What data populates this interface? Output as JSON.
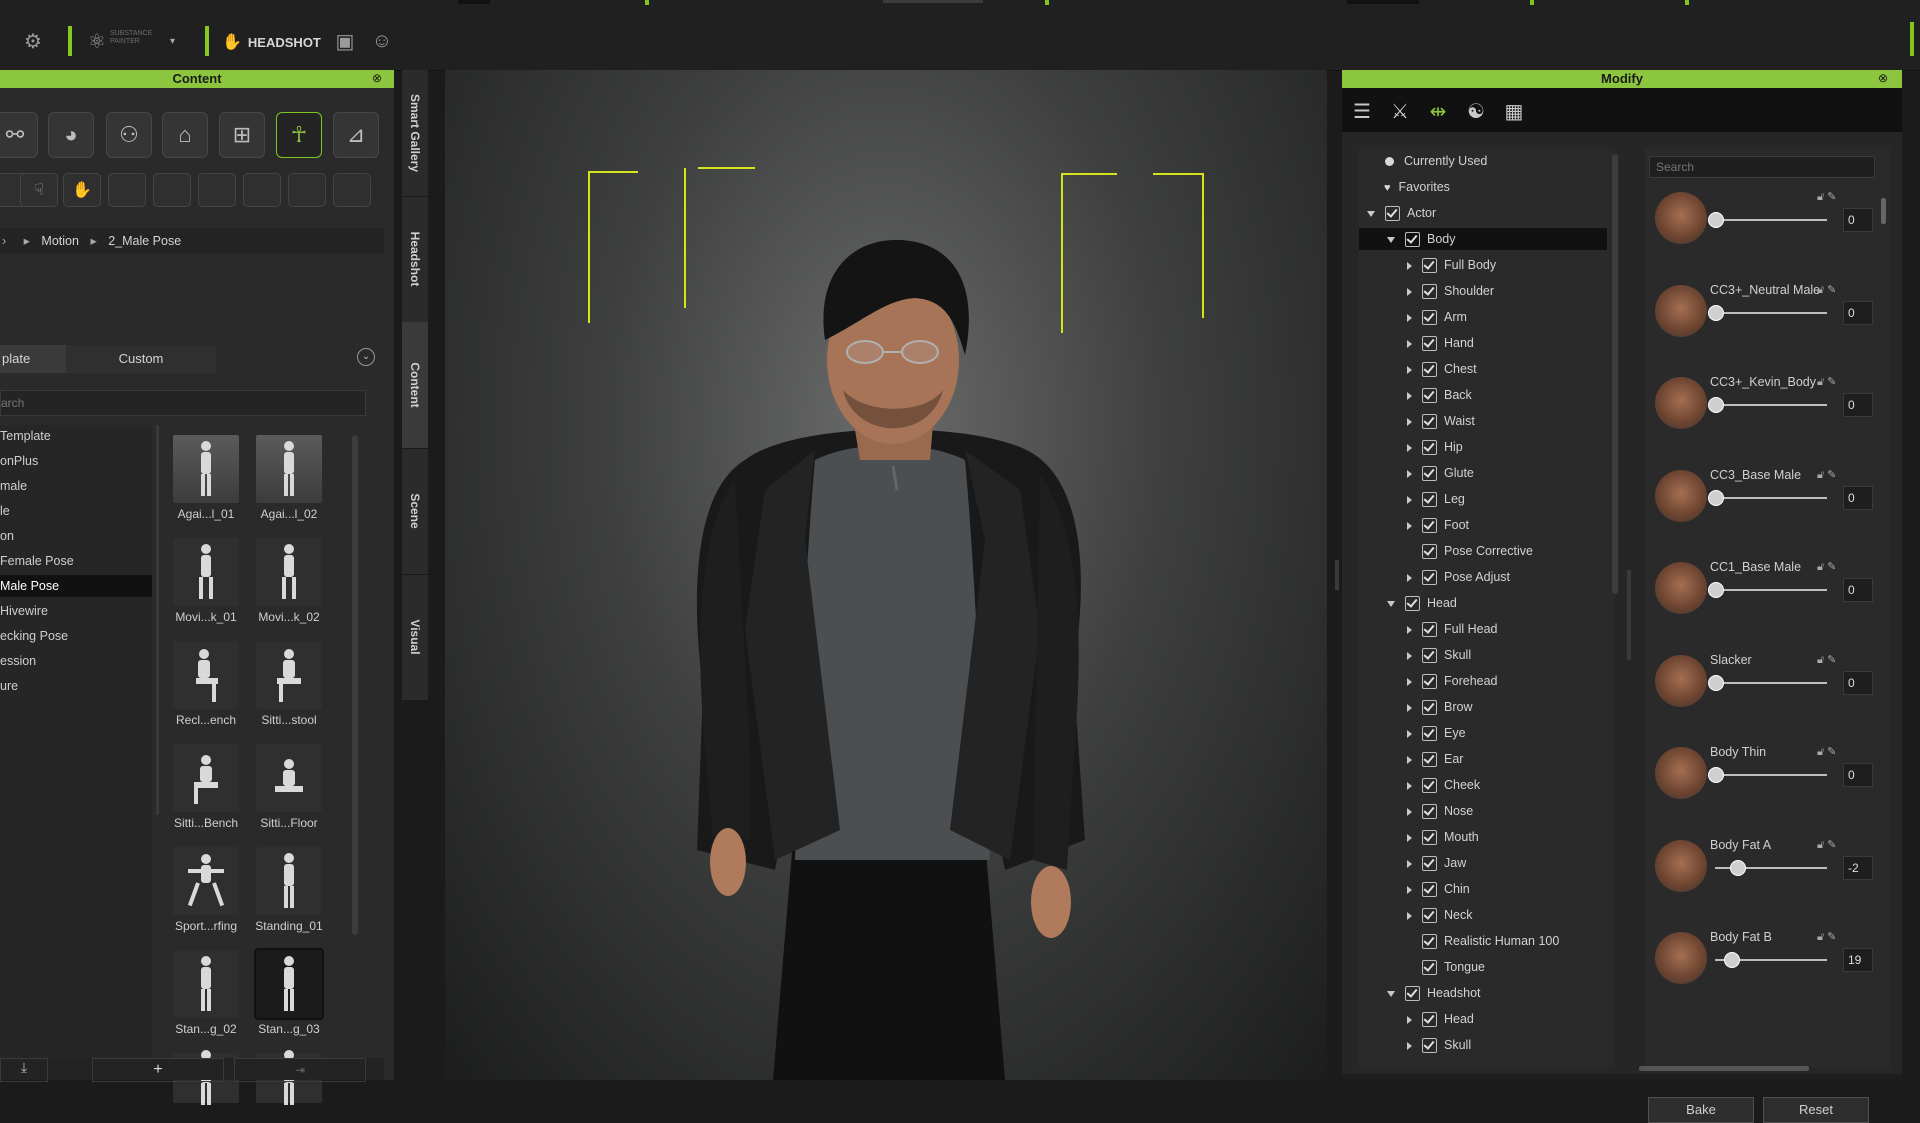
{
  "toolbar": {
    "substance_label": "SUBSTANCE PAINTER",
    "headshot_label": "HEADSHOT"
  },
  "content_panel": {
    "title": "Content",
    "breadcrumb": [
      "Motion",
      "2_Male Pose"
    ],
    "tabs": [
      "plate",
      "Custom"
    ],
    "search_placeholder": "arch",
    "list_items": [
      "Template",
      "onPlus",
      "male",
      "le",
      "on",
      "Female Pose",
      "Male Pose",
      "Hivewire",
      "ecking Pose",
      "ession",
      "ure"
    ],
    "selected_list_index": 6,
    "thumbnails": [
      "Agai...l_01",
      "Agai...l_02",
      "Movi...k_01",
      "Movi...k_02",
      "Recl...ench",
      "Sitti...stool",
      "Sitti...Bench",
      "Sitti...Floor",
      "Sport...rfing",
      "Standing_01",
      "Stan...g_02",
      "Stan...g_03"
    ],
    "selected_thumbnail_index": 11
  },
  "side_tabs": [
    "Smart Gallery",
    "Headshot",
    "Content",
    "Scene",
    "Visual"
  ],
  "modify_panel": {
    "title": "Modify",
    "search_placeholder": "Search",
    "tree": [
      {
        "label": "Currently Used",
        "level": 0,
        "kind": "dot"
      },
      {
        "label": "Favorites",
        "level": 0,
        "kind": "heart"
      },
      {
        "label": "Actor",
        "level": 0,
        "kind": "expanded"
      },
      {
        "label": "Body",
        "level": 1,
        "kind": "expanded",
        "selected": true
      },
      {
        "label": "Full Body",
        "level": 2,
        "kind": "collapsed"
      },
      {
        "label": "Shoulder",
        "level": 2,
        "kind": "collapsed"
      },
      {
        "label": "Arm",
        "level": 2,
        "kind": "collapsed"
      },
      {
        "label": "Hand",
        "level": 2,
        "kind": "collapsed"
      },
      {
        "label": "Chest",
        "level": 2,
        "kind": "collapsed"
      },
      {
        "label": "Back",
        "level": 2,
        "kind": "collapsed"
      },
      {
        "label": "Waist",
        "level": 2,
        "kind": "collapsed"
      },
      {
        "label": "Hip",
        "level": 2,
        "kind": "collapsed"
      },
      {
        "label": "Glute",
        "level": 2,
        "kind": "collapsed"
      },
      {
        "label": "Leg",
        "level": 2,
        "kind": "collapsed"
      },
      {
        "label": "Foot",
        "level": 2,
        "kind": "collapsed"
      },
      {
        "label": "Pose Corrective",
        "level": 2,
        "kind": "leaf"
      },
      {
        "label": "Pose Adjust",
        "level": 2,
        "kind": "collapsed"
      },
      {
        "label": "Head",
        "level": 1,
        "kind": "expanded"
      },
      {
        "label": "Full Head",
        "level": 2,
        "kind": "collapsed"
      },
      {
        "label": "Skull",
        "level": 2,
        "kind": "collapsed"
      },
      {
        "label": "Forehead",
        "level": 2,
        "kind": "collapsed"
      },
      {
        "label": "Brow",
        "level": 2,
        "kind": "collapsed"
      },
      {
        "label": "Eye",
        "level": 2,
        "kind": "collapsed"
      },
      {
        "label": "Ear",
        "level": 2,
        "kind": "collapsed"
      },
      {
        "label": "Cheek",
        "level": 2,
        "kind": "collapsed"
      },
      {
        "label": "Nose",
        "level": 2,
        "kind": "collapsed"
      },
      {
        "label": "Mouth",
        "level": 2,
        "kind": "collapsed"
      },
      {
        "label": "Jaw",
        "level": 2,
        "kind": "collapsed"
      },
      {
        "label": "Chin",
        "level": 2,
        "kind": "collapsed"
      },
      {
        "label": "Neck",
        "level": 2,
        "kind": "collapsed"
      },
      {
        "label": "Realistic Human 100",
        "level": 2,
        "kind": "leaf"
      },
      {
        "label": "Tongue",
        "level": 2,
        "kind": "leaf"
      },
      {
        "label": "Headshot",
        "level": 1,
        "kind": "expanded"
      },
      {
        "label": "Head",
        "level": 2,
        "kind": "collapsed"
      },
      {
        "label": "Skull",
        "level": 2,
        "kind": "collapsed"
      }
    ],
    "morphs": [
      {
        "name": "",
        "value": "0",
        "fraction": 0.0
      },
      {
        "name": "CC3+_Neutral Male",
        "value": "0",
        "fraction": 0.0
      },
      {
        "name": "CC3+_Kevin_Body",
        "value": "0",
        "fraction": 0.0
      },
      {
        "name": "CC3_Base Male",
        "value": "0",
        "fraction": 0.0
      },
      {
        "name": "CC1_Base Male",
        "value": "0",
        "fraction": 0.0
      },
      {
        "name": "Slacker",
        "value": "0",
        "fraction": 0.0
      },
      {
        "name": "Body Thin",
        "value": "0",
        "fraction": 0.0
      },
      {
        "name": "Body Fat A",
        "value": "-2",
        "fraction": 0.2
      },
      {
        "name": "Body Fat B",
        "value": "19",
        "fraction": 0.14
      }
    ],
    "bake_label": "Bake",
    "reset_label": "Reset"
  },
  "colors": {
    "accent": "#8cc63f",
    "guide_lines": "#d7e21a"
  }
}
